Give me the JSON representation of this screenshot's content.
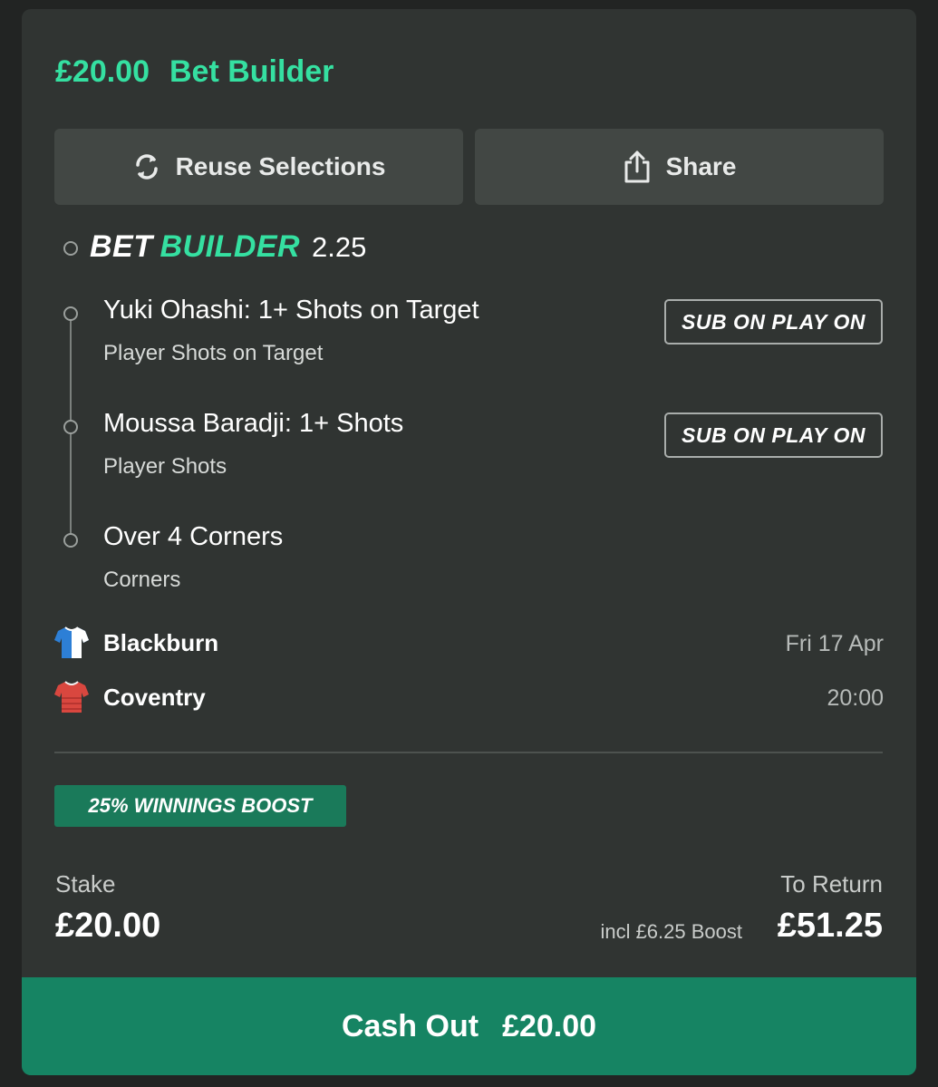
{
  "header": {
    "stake_amount": "£20.00",
    "bet_type": "Bet Builder"
  },
  "actions": {
    "reuse_label": "Reuse Selections",
    "share_label": "Share"
  },
  "bet_builder": {
    "logo_part1": "BET",
    "logo_part2": "BUILDER",
    "odds": "2.25",
    "selections": [
      {
        "title": "Yuki Ohashi: 1+ Shots on Target",
        "market": "Player Shots on Target",
        "badge": "SUB ON PLAY ON"
      },
      {
        "title": "Moussa Baradji: 1+ Shots",
        "market": "Player Shots",
        "badge": "SUB ON PLAY ON"
      },
      {
        "title": "Over 4 Corners",
        "market": "Corners"
      }
    ]
  },
  "match": {
    "home": "Blackburn",
    "away": "Coventry",
    "date": "Fri 17 Apr",
    "time": "20:00"
  },
  "boost": {
    "label": "25% WINNINGS BOOST",
    "note": "incl £6.25 Boost"
  },
  "summary": {
    "stake_label": "Stake",
    "stake_value": "£20.00",
    "return_label": "To Return",
    "return_value": "£51.25"
  },
  "cashout": {
    "label": "Cash Out",
    "amount": "£20.00"
  },
  "colors": {
    "accent": "#35e0a1",
    "cashout_bg": "#168463",
    "boost_bg": "#1a7a5a",
    "card_bg": "#303432"
  }
}
